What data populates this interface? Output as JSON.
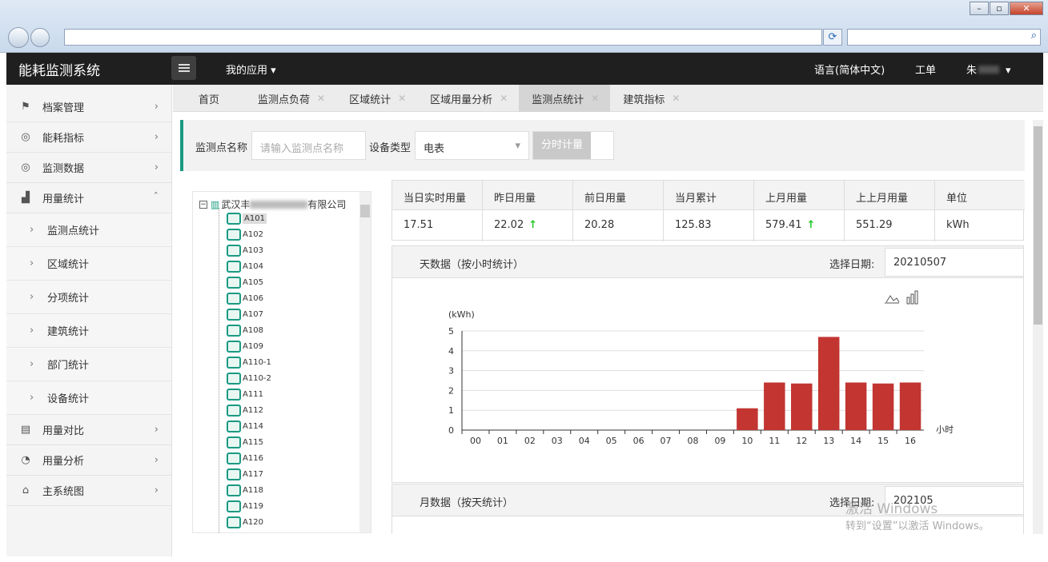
{
  "app": {
    "title": "能耗监测系统",
    "my_apps": "我的应用",
    "language": "语言(简体中文)",
    "workorder": "工单",
    "user": "朱"
  },
  "sidebar": [
    {
      "label": "档案管理",
      "icon": "camera-icon"
    },
    {
      "label": "能耗指标",
      "icon": "gauge-icon"
    },
    {
      "label": "监测数据",
      "icon": "gauge-icon"
    },
    {
      "label": "用量统计",
      "icon": "bar-chart-icon"
    },
    {
      "label": "用量对比",
      "icon": "list-icon"
    },
    {
      "label": "用量分析",
      "icon": "pie-icon"
    },
    {
      "label": "主系统图",
      "icon": "home-icon"
    }
  ],
  "sub_items": [
    "监测点统计",
    "区域统计",
    "分项统计",
    "建筑统计",
    "部门统计",
    "设备统计"
  ],
  "tabs": [
    {
      "label": "首页",
      "closable": false,
      "active": false
    },
    {
      "label": "监测点负荷",
      "closable": true,
      "active": false
    },
    {
      "label": "区域统计",
      "closable": true,
      "active": false
    },
    {
      "label": "区域用量分析",
      "closable": true,
      "active": false
    },
    {
      "label": "监测点统计",
      "closable": true,
      "active": true
    },
    {
      "label": "建筑指标",
      "closable": true,
      "active": false
    }
  ],
  "filter": {
    "name_label": "监测点名称",
    "name_placeholder": "请输入监测点名称",
    "type_label": "设备类型",
    "type_value": "电表",
    "toggle_label": "分时计量"
  },
  "tree": {
    "root": "武汉丰",
    "root_suffix": "有限公司",
    "nodes": [
      "A101",
      "A102",
      "A103",
      "A104",
      "A105",
      "A106",
      "A107",
      "A108",
      "A109",
      "A110-1",
      "A110-2",
      "A111",
      "A112",
      "A114",
      "A115",
      "A116",
      "A117",
      "A118",
      "A119",
      "A120"
    ],
    "selected": "A101"
  },
  "stats": [
    {
      "header": "当日实时用量",
      "value": "17.51",
      "up": false
    },
    {
      "header": "昨日用量",
      "value": "22.02",
      "up": true
    },
    {
      "header": "前日用量",
      "value": "20.28",
      "up": false
    },
    {
      "header": "当月累计",
      "value": "125.83",
      "up": false
    },
    {
      "header": "上月用量",
      "value": "579.41",
      "up": true
    },
    {
      "header": "上上月用量",
      "value": "551.29",
      "up": false
    },
    {
      "header": "单位",
      "value": "kWh",
      "up": false
    }
  ],
  "day_panel": {
    "title": "天数据（按小时统计）",
    "date_label": "选择日期:",
    "date": "20210507"
  },
  "month_panel": {
    "title": "月数据（按天统计）",
    "date_label": "选择日期:",
    "date": "202105"
  },
  "chart_data": {
    "type": "bar",
    "ylabel": "(kWh)",
    "xlabel": "小时",
    "ylim": [
      0,
      5
    ],
    "yticks": [
      0,
      1,
      2,
      3,
      4,
      5
    ],
    "categories": [
      "00",
      "01",
      "02",
      "03",
      "04",
      "05",
      "06",
      "07",
      "08",
      "09",
      "10",
      "11",
      "12",
      "13",
      "14",
      "15",
      "16"
    ],
    "values": [
      0,
      0,
      0,
      0,
      0,
      0,
      0,
      0,
      0,
      0,
      1.1,
      2.4,
      2.35,
      4.7,
      2.4,
      2.35,
      2.4
    ],
    "color": "#c23531",
    "grid": true
  },
  "watermark": {
    "line1": "激活 Windows",
    "line2": "转到“设置”以激活 Windows。"
  }
}
